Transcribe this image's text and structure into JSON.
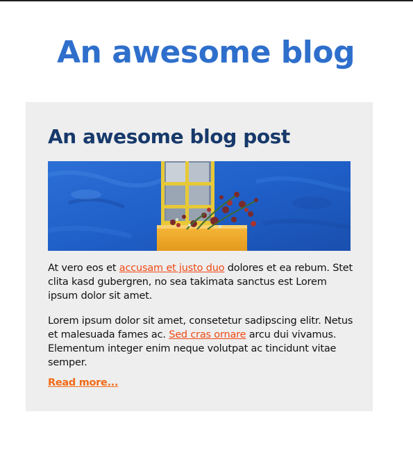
{
  "site": {
    "title": "An awesome blog"
  },
  "post": {
    "title": "An awesome blog post",
    "image_alt": "Window in a blue wall with a yellow flower box",
    "paragraph1": {
      "before": "At vero eos et ",
      "link": "accusam et justo duo",
      "after": " dolores et ea rebum. Stet clita kasd gubergren, no sea takimata sanctus est Lorem ipsum dolor sit amet."
    },
    "paragraph2": {
      "before": "Lorem ipsum dolor sit amet, consetetur sadipscing elitr. Netus et malesuada fames ac. ",
      "link": "Sed cras ornare",
      "after": " arcu dui vivamus. Elementum integer enim neque volutpat ac tincidunt vitae semper."
    },
    "read_more": "Read more..."
  },
  "colors": {
    "site_title": "#2f6fcc",
    "post_title": "#17396b",
    "card_bg": "#eeeeee",
    "link": "#f04a14",
    "read_more": "#f26a16"
  }
}
